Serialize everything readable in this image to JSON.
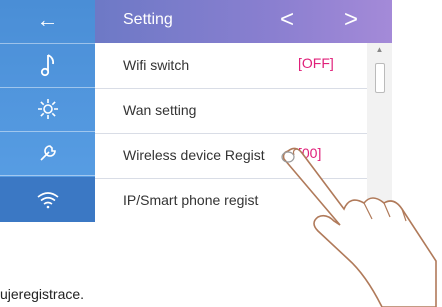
{
  "screen": {
    "title": "Setting",
    "nav_prev": "<",
    "nav_next": ">"
  },
  "sidebar": {
    "items": [
      {
        "name": "back-arrow-icon",
        "glyph": "←",
        "selected": false
      },
      {
        "name": "music-note-icon",
        "glyph": "♪",
        "selected": false
      },
      {
        "name": "gear-icon",
        "glyph": "⚙",
        "selected": false
      },
      {
        "name": "wrench-icon",
        "glyph": "🔧",
        "selected": false
      },
      {
        "name": "wifi-icon",
        "glyph": "wifi",
        "selected": true
      }
    ]
  },
  "list": {
    "rows": [
      {
        "label": "Wifi switch",
        "value": "[OFF]"
      },
      {
        "label": "Wan setting",
        "value": ""
      },
      {
        "label": "Wireless device Regist",
        "value": "[00]"
      },
      {
        "label": "IP/Smart phone regist",
        "value": ""
      }
    ]
  },
  "caption": "ujeregistrace.",
  "colors": {
    "sidebar": "#4a8ed6",
    "header": "#8a7fd0",
    "value": "#e0207a"
  }
}
